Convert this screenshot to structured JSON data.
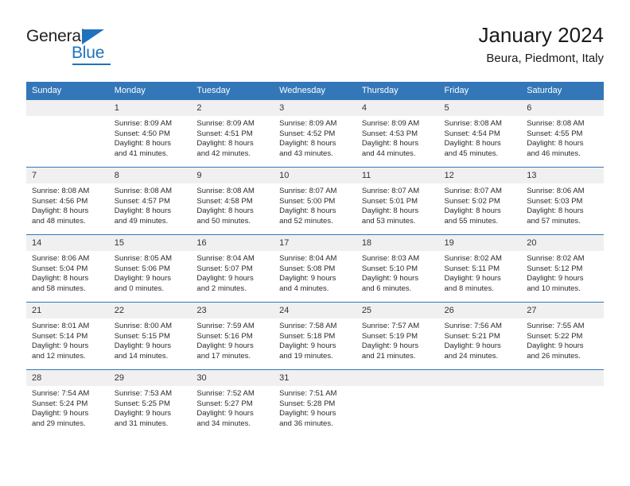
{
  "brand": {
    "name_part1": "General",
    "name_part2": "Blue",
    "accent_color": "#1f72bd"
  },
  "header": {
    "title": "January 2024",
    "subtitle": "Beura, Piedmont, Italy"
  },
  "theme": {
    "header_bg": "#3477b9",
    "daynum_bg": "#f0f0f0",
    "text": "#2b2b2b"
  },
  "weekday_headers": [
    "Sunday",
    "Monday",
    "Tuesday",
    "Wednesday",
    "Thursday",
    "Friday",
    "Saturday"
  ],
  "weeks": [
    [
      {
        "day": "",
        "sunrise": "",
        "sunset": "",
        "daylight1": "",
        "daylight2": "",
        "empty": true
      },
      {
        "day": "1",
        "sunrise": "Sunrise: 8:09 AM",
        "sunset": "Sunset: 4:50 PM",
        "daylight1": "Daylight: 8 hours",
        "daylight2": "and 41 minutes."
      },
      {
        "day": "2",
        "sunrise": "Sunrise: 8:09 AM",
        "sunset": "Sunset: 4:51 PM",
        "daylight1": "Daylight: 8 hours",
        "daylight2": "and 42 minutes."
      },
      {
        "day": "3",
        "sunrise": "Sunrise: 8:09 AM",
        "sunset": "Sunset: 4:52 PM",
        "daylight1": "Daylight: 8 hours",
        "daylight2": "and 43 minutes."
      },
      {
        "day": "4",
        "sunrise": "Sunrise: 8:09 AM",
        "sunset": "Sunset: 4:53 PM",
        "daylight1": "Daylight: 8 hours",
        "daylight2": "and 44 minutes."
      },
      {
        "day": "5",
        "sunrise": "Sunrise: 8:08 AM",
        "sunset": "Sunset: 4:54 PM",
        "daylight1": "Daylight: 8 hours",
        "daylight2": "and 45 minutes."
      },
      {
        "day": "6",
        "sunrise": "Sunrise: 8:08 AM",
        "sunset": "Sunset: 4:55 PM",
        "daylight1": "Daylight: 8 hours",
        "daylight2": "and 46 minutes."
      }
    ],
    [
      {
        "day": "7",
        "sunrise": "Sunrise: 8:08 AM",
        "sunset": "Sunset: 4:56 PM",
        "daylight1": "Daylight: 8 hours",
        "daylight2": "and 48 minutes."
      },
      {
        "day": "8",
        "sunrise": "Sunrise: 8:08 AM",
        "sunset": "Sunset: 4:57 PM",
        "daylight1": "Daylight: 8 hours",
        "daylight2": "and 49 minutes."
      },
      {
        "day": "9",
        "sunrise": "Sunrise: 8:08 AM",
        "sunset": "Sunset: 4:58 PM",
        "daylight1": "Daylight: 8 hours",
        "daylight2": "and 50 minutes."
      },
      {
        "day": "10",
        "sunrise": "Sunrise: 8:07 AM",
        "sunset": "Sunset: 5:00 PM",
        "daylight1": "Daylight: 8 hours",
        "daylight2": "and 52 minutes."
      },
      {
        "day": "11",
        "sunrise": "Sunrise: 8:07 AM",
        "sunset": "Sunset: 5:01 PM",
        "daylight1": "Daylight: 8 hours",
        "daylight2": "and 53 minutes."
      },
      {
        "day": "12",
        "sunrise": "Sunrise: 8:07 AM",
        "sunset": "Sunset: 5:02 PM",
        "daylight1": "Daylight: 8 hours",
        "daylight2": "and 55 minutes."
      },
      {
        "day": "13",
        "sunrise": "Sunrise: 8:06 AM",
        "sunset": "Sunset: 5:03 PM",
        "daylight1": "Daylight: 8 hours",
        "daylight2": "and 57 minutes."
      }
    ],
    [
      {
        "day": "14",
        "sunrise": "Sunrise: 8:06 AM",
        "sunset": "Sunset: 5:04 PM",
        "daylight1": "Daylight: 8 hours",
        "daylight2": "and 58 minutes."
      },
      {
        "day": "15",
        "sunrise": "Sunrise: 8:05 AM",
        "sunset": "Sunset: 5:06 PM",
        "daylight1": "Daylight: 9 hours",
        "daylight2": "and 0 minutes."
      },
      {
        "day": "16",
        "sunrise": "Sunrise: 8:04 AM",
        "sunset": "Sunset: 5:07 PM",
        "daylight1": "Daylight: 9 hours",
        "daylight2": "and 2 minutes."
      },
      {
        "day": "17",
        "sunrise": "Sunrise: 8:04 AM",
        "sunset": "Sunset: 5:08 PM",
        "daylight1": "Daylight: 9 hours",
        "daylight2": "and 4 minutes."
      },
      {
        "day": "18",
        "sunrise": "Sunrise: 8:03 AM",
        "sunset": "Sunset: 5:10 PM",
        "daylight1": "Daylight: 9 hours",
        "daylight2": "and 6 minutes."
      },
      {
        "day": "19",
        "sunrise": "Sunrise: 8:02 AM",
        "sunset": "Sunset: 5:11 PM",
        "daylight1": "Daylight: 9 hours",
        "daylight2": "and 8 minutes."
      },
      {
        "day": "20",
        "sunrise": "Sunrise: 8:02 AM",
        "sunset": "Sunset: 5:12 PM",
        "daylight1": "Daylight: 9 hours",
        "daylight2": "and 10 minutes."
      }
    ],
    [
      {
        "day": "21",
        "sunrise": "Sunrise: 8:01 AM",
        "sunset": "Sunset: 5:14 PM",
        "daylight1": "Daylight: 9 hours",
        "daylight2": "and 12 minutes."
      },
      {
        "day": "22",
        "sunrise": "Sunrise: 8:00 AM",
        "sunset": "Sunset: 5:15 PM",
        "daylight1": "Daylight: 9 hours",
        "daylight2": "and 14 minutes."
      },
      {
        "day": "23",
        "sunrise": "Sunrise: 7:59 AM",
        "sunset": "Sunset: 5:16 PM",
        "daylight1": "Daylight: 9 hours",
        "daylight2": "and 17 minutes."
      },
      {
        "day": "24",
        "sunrise": "Sunrise: 7:58 AM",
        "sunset": "Sunset: 5:18 PM",
        "daylight1": "Daylight: 9 hours",
        "daylight2": "and 19 minutes."
      },
      {
        "day": "25",
        "sunrise": "Sunrise: 7:57 AM",
        "sunset": "Sunset: 5:19 PM",
        "daylight1": "Daylight: 9 hours",
        "daylight2": "and 21 minutes."
      },
      {
        "day": "26",
        "sunrise": "Sunrise: 7:56 AM",
        "sunset": "Sunset: 5:21 PM",
        "daylight1": "Daylight: 9 hours",
        "daylight2": "and 24 minutes."
      },
      {
        "day": "27",
        "sunrise": "Sunrise: 7:55 AM",
        "sunset": "Sunset: 5:22 PM",
        "daylight1": "Daylight: 9 hours",
        "daylight2": "and 26 minutes."
      }
    ],
    [
      {
        "day": "28",
        "sunrise": "Sunrise: 7:54 AM",
        "sunset": "Sunset: 5:24 PM",
        "daylight1": "Daylight: 9 hours",
        "daylight2": "and 29 minutes."
      },
      {
        "day": "29",
        "sunrise": "Sunrise: 7:53 AM",
        "sunset": "Sunset: 5:25 PM",
        "daylight1": "Daylight: 9 hours",
        "daylight2": "and 31 minutes."
      },
      {
        "day": "30",
        "sunrise": "Sunrise: 7:52 AM",
        "sunset": "Sunset: 5:27 PM",
        "daylight1": "Daylight: 9 hours",
        "daylight2": "and 34 minutes."
      },
      {
        "day": "31",
        "sunrise": "Sunrise: 7:51 AM",
        "sunset": "Sunset: 5:28 PM",
        "daylight1": "Daylight: 9 hours",
        "daylight2": "and 36 minutes."
      },
      {
        "day": "",
        "sunrise": "",
        "sunset": "",
        "daylight1": "",
        "daylight2": "",
        "empty": true
      },
      {
        "day": "",
        "sunrise": "",
        "sunset": "",
        "daylight1": "",
        "daylight2": "",
        "empty": true
      },
      {
        "day": "",
        "sunrise": "",
        "sunset": "",
        "daylight1": "",
        "daylight2": "",
        "empty": true
      }
    ]
  ]
}
